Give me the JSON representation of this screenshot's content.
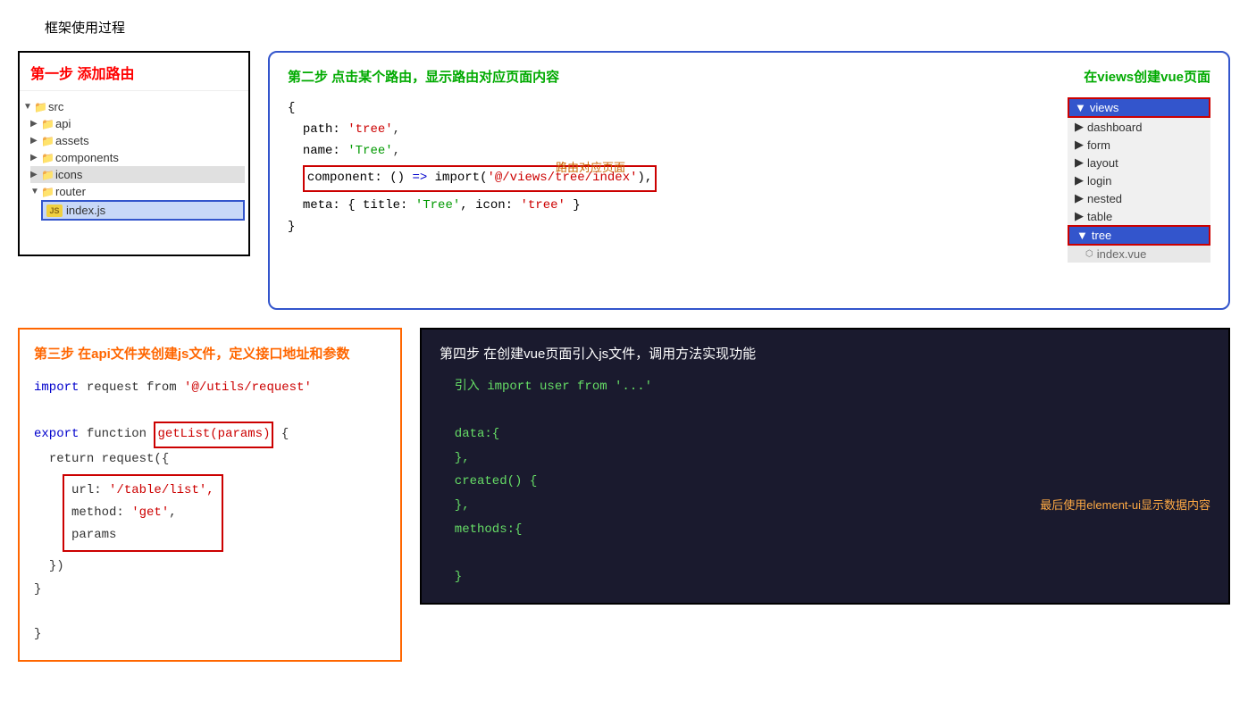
{
  "pageTitle": "框架使用过程",
  "step1": {
    "title": "第一步 添加路由",
    "tree": {
      "src": "src",
      "api": "api",
      "assets": "assets",
      "components": "components",
      "icons": "icons",
      "router": "router",
      "indexjs": "index.js"
    }
  },
  "step2": {
    "title": "第二步 点击某个路由，显示路由对应页面内容",
    "subtitle": "在views创建vue页面",
    "annotation": "路由对应页面",
    "code": {
      "line1": "{",
      "line2": "  path: 'tree',",
      "line3": "  name: 'Tree',",
      "line4": "  component: () => import('@/views/tree/index'),",
      "line5": "  meta: { title: 'Tree', icon: 'tree' }",
      "line6": "}"
    },
    "viewsTree": {
      "views": "views",
      "dashboard": "dashboard",
      "form": "form",
      "layout": "layout",
      "login": "login",
      "nested": "nested",
      "table": "table",
      "tree": "tree",
      "indexvue": "index.vue"
    }
  },
  "step3": {
    "title": "第三步 在api文件夹创建js文件，定义接口地址和参数",
    "code": {
      "import": "import request from '@/utils/request'",
      "export": "export function getList(params) {",
      "return": "  return request({",
      "url": "    url: '/table/list',",
      "method": "    method: 'get',",
      "params": "    params",
      "close1": "  })",
      "close2": "}",
      "close3": "}"
    }
  },
  "step4": {
    "title": "第四步 在创建vue页面引入js文件，调用方法实现功能",
    "annotation1": "最后使用element-ui显示数据内容",
    "code": {
      "line1": "  引入 import user from '...'",
      "line2": "  data:{",
      "line3": "  },",
      "line4": "  created() {",
      "line5": "  },",
      "line6": "  methods:{",
      "line7": "  }"
    }
  }
}
